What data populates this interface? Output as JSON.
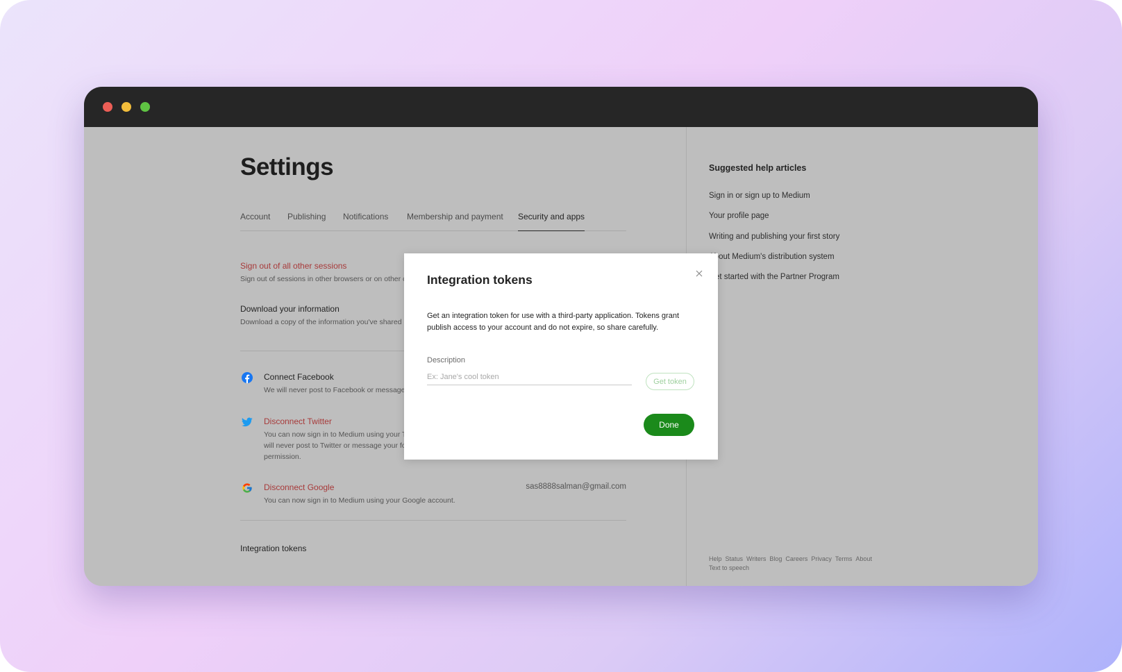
{
  "window": {
    "controls": [
      "close",
      "minimize",
      "maximize"
    ]
  },
  "settings": {
    "title": "Settings",
    "tabs": [
      {
        "label": "Account"
      },
      {
        "label": "Publishing"
      },
      {
        "label": "Notifications"
      },
      {
        "label": "Membership and payment"
      },
      {
        "label": "Security and apps",
        "active": true
      }
    ],
    "sign_out": {
      "title": "Sign out of all other sessions",
      "desc": "Sign out of sessions in other browsers or on other computers."
    },
    "download": {
      "title": "Download your information",
      "desc": "Download a copy of the information you've shared on Medium."
    },
    "facebook": {
      "icon": "facebook-icon",
      "title": "Connect Facebook",
      "desc": "We will never post to Facebook or message your friends without your permission."
    },
    "twitter": {
      "icon": "twitter-icon",
      "title": "Disconnect Twitter",
      "desc_line1": "You can now sign in to Medium using your Twitter account. We",
      "desc_line2": "will never post to Twitter or message your followers without your",
      "desc_line3": "permission."
    },
    "google": {
      "icon": "google-icon",
      "title": "Disconnect Google",
      "desc": "You can now sign in to Medium using your Google account.",
      "email": "sas8888salman@gmail.com"
    },
    "integration": {
      "title": "Integration tokens"
    }
  },
  "help": {
    "title": "Suggested help articles",
    "links": [
      "Sign in or sign up to Medium",
      "Your profile page",
      "Writing and publishing your first story",
      "About Medium's distribution system",
      "Get started with the Partner Program"
    ],
    "footer_links": [
      "Help",
      "Status",
      "Writers",
      "Blog",
      "Careers",
      "Privacy",
      "Terms",
      "About",
      "Text to speech"
    ]
  },
  "modal": {
    "title": "Integration tokens",
    "desc": "Get an integration token for use with a third-party application. Tokens grant publish access to your account and do not expire, so share carefully.",
    "field_label": "Description",
    "input_placeholder": "Ex: Jane's cool token",
    "input_value": "",
    "get_token_label": "Get token",
    "done_label": "Done",
    "close_icon": "close-icon"
  },
  "colors": {
    "brand_green": "#1b8a1b",
    "danger_red": "#a73a3a",
    "facebook_blue": "#1877f2",
    "twitter_blue": "#1d9bf0"
  }
}
